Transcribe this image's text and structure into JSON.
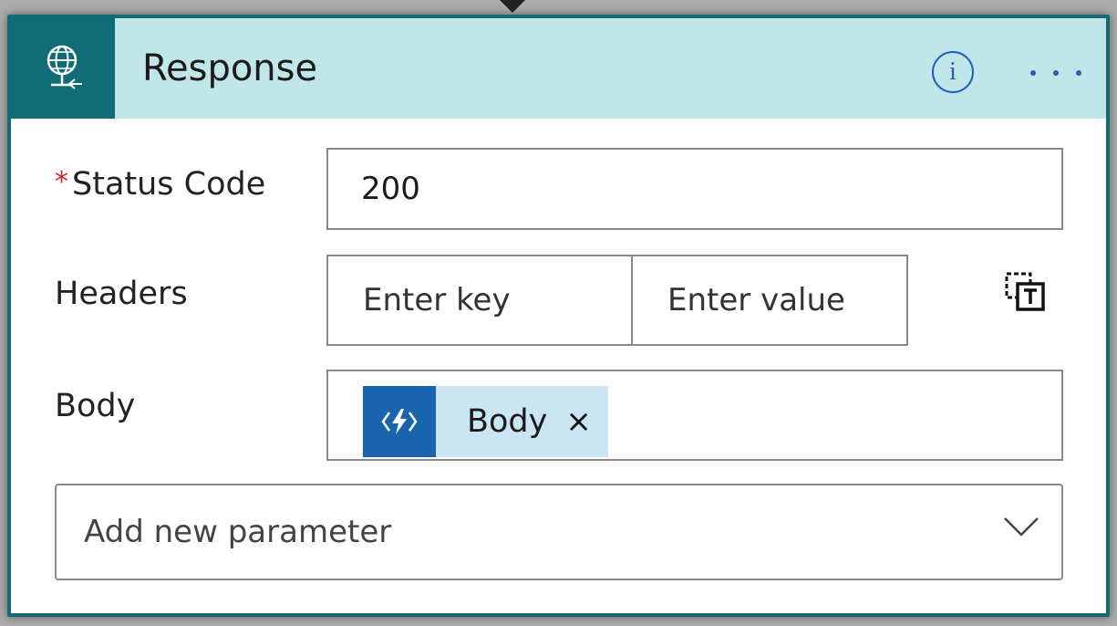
{
  "card": {
    "title": "Response",
    "header_icon": "globe-response-icon",
    "info_label": "i",
    "colors": {
      "header_bg": "#c1e6e9",
      "icon_bg": "#106c75",
      "border": "#116a74",
      "accent": "#1f5fb8",
      "required": "#d3222a"
    }
  },
  "fields": {
    "status_code": {
      "required_mark": "*",
      "label": "Status Code",
      "value": "200"
    },
    "headers": {
      "label": "Headers",
      "key_placeholder": "Enter key",
      "value_placeholder": "Enter value",
      "toggle_icon": "switch-to-text-mode-icon"
    },
    "body": {
      "label": "Body",
      "token": {
        "label": "Body",
        "icon": "azure-function-icon",
        "remove": "×"
      }
    }
  },
  "add_parameter": {
    "label": "Add new parameter",
    "icon": "chevron-down-icon"
  }
}
